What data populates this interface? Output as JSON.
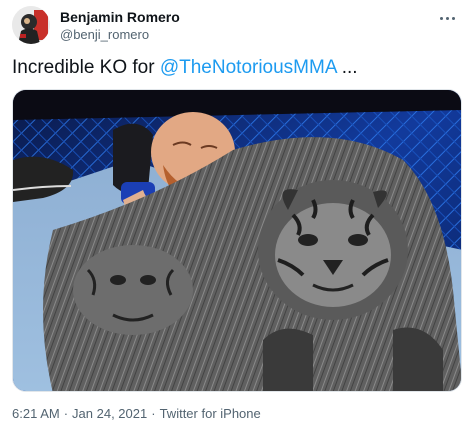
{
  "user": {
    "display_name": "Benjamin Romero",
    "handle": "@benji_romero",
    "avatar_icon": "avatar-photo"
  },
  "tweet": {
    "text_before": "Incredible KO for ",
    "mention": "@TheNotoriousMMA",
    "text_after": " ...",
    "media_description_icon": "photo"
  },
  "meta": {
    "time": "6:21 AM",
    "date": "Jan 24, 2021",
    "source": "Twitter for iPhone",
    "separator": "·"
  },
  "colors": {
    "mention": "#1d9bf0",
    "secondary_text": "#536471",
    "primary_text": "#0f1419"
  }
}
